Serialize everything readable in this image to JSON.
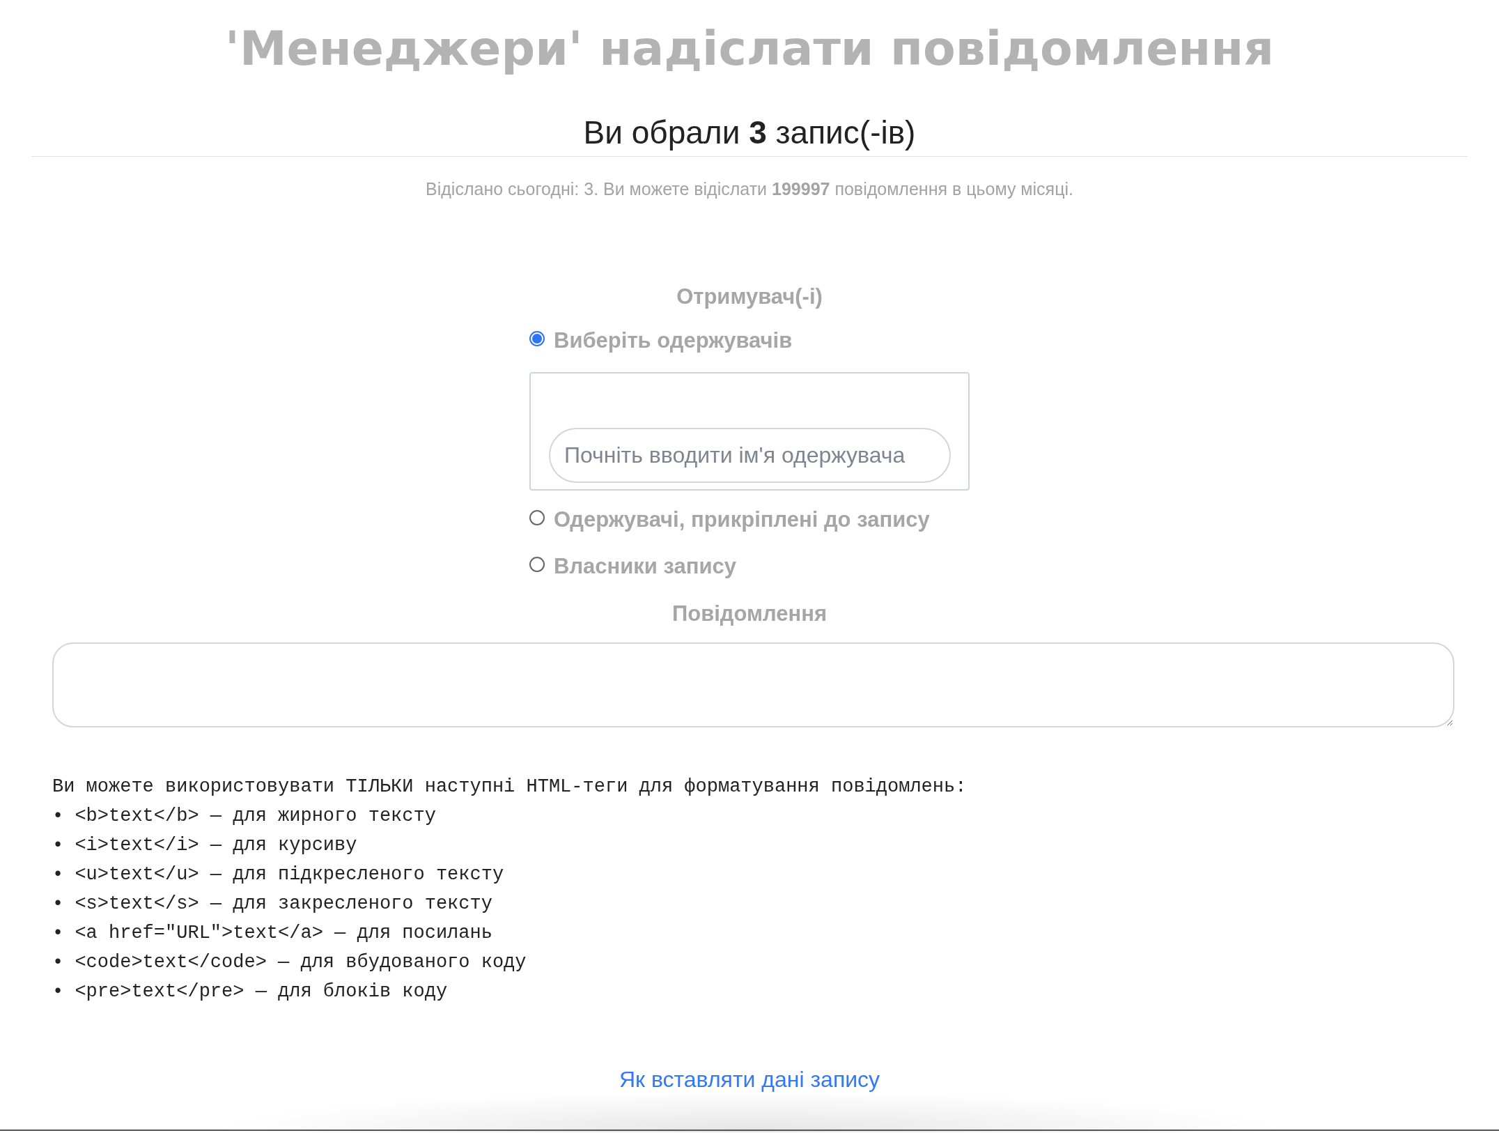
{
  "title": "'Менеджери' надіслати повідомлення",
  "selection_summary": "Ви обрали **3** запис(-ів)",
  "quota_info": "Відіслано сьогодні: 3. Ви можете відіслати **199997** повідомлення в цьому місяці.",
  "recipients": {
    "label": "Отримувач(-і)",
    "options": [
      {
        "label": "Виберіть одержувачів",
        "selected": true,
        "search": {
          "placeholder": "Почніть вводити ім'я одержувача"
        }
      },
      {
        "label": "Одержувачі, прикріплені до запису",
        "selected": false
      },
      {
        "label": "Власники запису",
        "selected": false
      }
    ]
  },
  "message": {
    "label": "Повідомлення"
  },
  "formatting_help": {
    "intro": "Ви можете використовувати ТІЛЬКИ наступні HTML-теги для форматування повідомлень:",
    "items": [
      "• <b>text</b> — для жирного тексту",
      "• <i>text</i> — для курсиву",
      "• <u>text</u> — для підкресленого тексту",
      "• <s>text</s> — для закресленого тексту",
      "• <a href=\"URL\">text</a> — для посилань",
      "• <code>text</code> — для вбудованого коду",
      "• <pre>text</pre> — для блоків коду"
    ]
  },
  "help_link": "Як вставляти дані запису"
}
